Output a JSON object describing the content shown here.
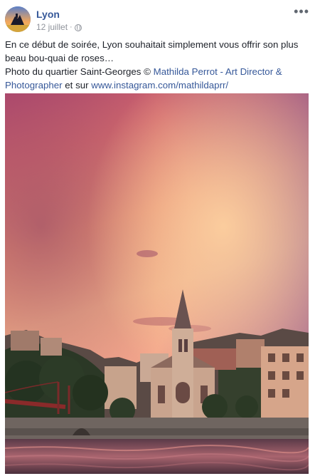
{
  "post": {
    "page_name": "Lyon",
    "date": "12 juillet",
    "date_separator": "·",
    "more_label": "•••",
    "text_line1": "En ce début de soirée, Lyon souhaitait simplement vous offrir son plus beau bou-quai de roses…",
    "text_credit_prefix": "Photo du quartier Saint-Georges © ",
    "credit_link": "Mathilda Perrot - Art Director & Photographer",
    "text_and": " et sur ",
    "instagram_link": "www.instagram.com/mathildaprr/"
  },
  "icons": {
    "privacy": "globe-icon",
    "options": "more-options-icon"
  },
  "colors": {
    "link": "#365899",
    "text": "#1d2129",
    "meta": "#90949c"
  }
}
